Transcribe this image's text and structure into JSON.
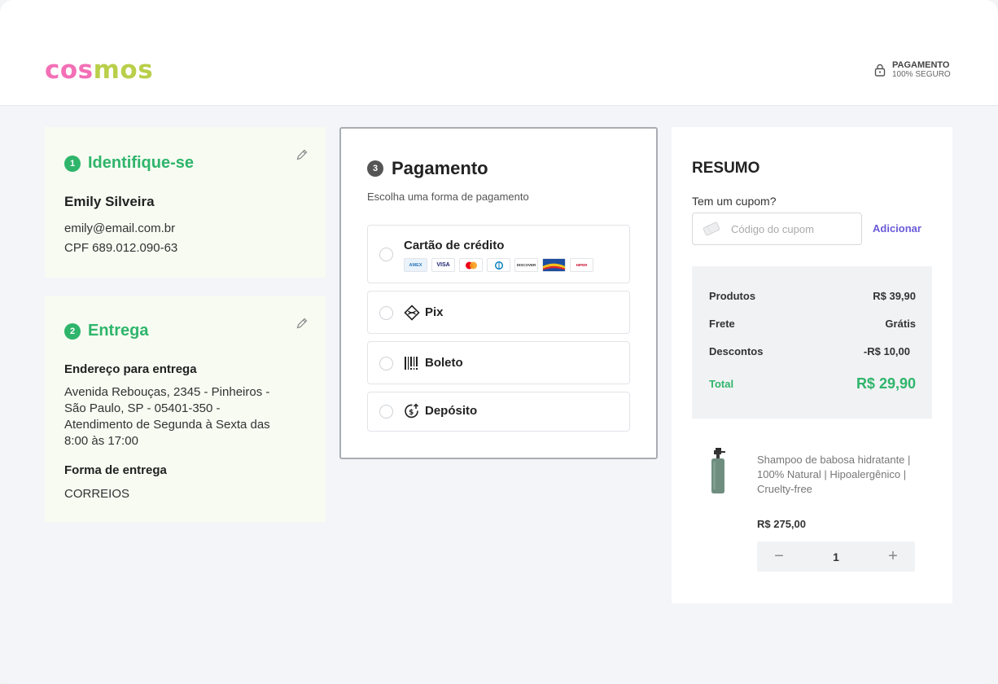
{
  "brand": {
    "part1": "cos",
    "part2": "mos"
  },
  "secure": {
    "line1": "PAGAMENTO",
    "line2": "100% SEGURO"
  },
  "identify": {
    "step": "1",
    "title": "Identifique-se",
    "name": "Emily Silveira",
    "email": "emily@email.com.br",
    "cpf": "CPF 689.012.090-63"
  },
  "delivery": {
    "step": "2",
    "title": "Entrega",
    "address_label": "Endereço para entrega",
    "address": "Avenida Rebouças, 2345 - Pinheiros - São Paulo, SP -  05401-350 - Atendimento de Segunda à Sexta das 8:00 às 17:00",
    "method_label": "Forma de entrega",
    "method": "CORREIOS"
  },
  "payment": {
    "step": "3",
    "title": "Pagamento",
    "subtitle": "Escolha uma forma de pagamento",
    "options": [
      {
        "label": "Cartão de crédito"
      },
      {
        "label": "Pix"
      },
      {
        "label": "Boleto"
      },
      {
        "label": "Depósito"
      }
    ],
    "brands": [
      {
        "name": "AMEX",
        "color": "#2e77bb"
      },
      {
        "name": "VISA",
        "color": "#1a1f71"
      },
      {
        "name": "MC",
        "color": "#eb001b"
      },
      {
        "name": "DC",
        "color": "#0079be"
      },
      {
        "name": "DISCOVER",
        "color": "#e55c20"
      },
      {
        "name": "ELO",
        "color": "#1d4ea0"
      },
      {
        "name": "HIPER",
        "color": "#c8102e"
      }
    ]
  },
  "summary": {
    "title": "RESUMO",
    "coupon_label": "Tem um cupom?",
    "coupon_placeholder": "Código do cupom",
    "add_label": "Adicionar",
    "rows": [
      {
        "label": "Produtos",
        "value": "R$ 39,90"
      },
      {
        "label": "Frete",
        "value": "Grátis"
      },
      {
        "label": "Descontos",
        "value": "-R$ 10,00"
      }
    ],
    "total_label": "Total",
    "total_value": "R$ 29,90",
    "product": {
      "name": "Shampoo de babosa hidratante | 100% Natural | Hipoalergênico | Cruelty-free",
      "price": "R$ 275,00",
      "quantity": "1",
      "minus": "−",
      "plus": "+"
    }
  },
  "colors": {
    "green": "#2fb56b",
    "pink": "#f36fb6",
    "lime": "#b9cf4a",
    "purple": "#6a5bd8"
  }
}
